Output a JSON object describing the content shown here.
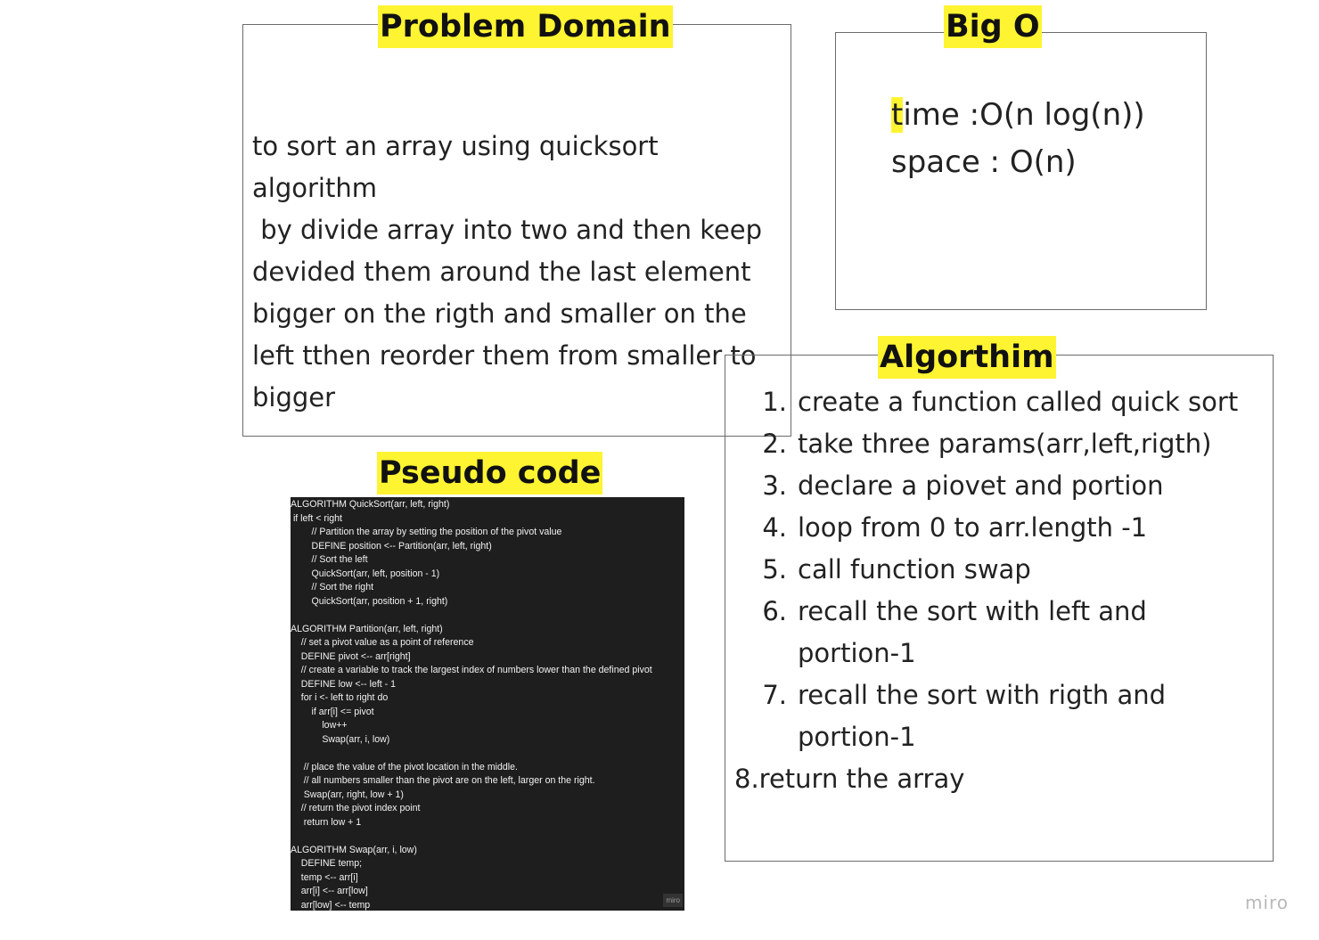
{
  "problem_domain": {
    "heading": "Problem Domain",
    "text": "to sort an array using quicksort algorithm\n by divide array into two and then keep devided them around the last element bigger on the rigth and smaller on the left tthen reorder them from smaller to bigger"
  },
  "big_o": {
    "heading": "Big O",
    "time_highlight": "t",
    "time_rest": "ime :O(n log(n))",
    "space": "space : O(n)"
  },
  "algorithm": {
    "heading": "Algorthim",
    "steps": [
      {
        "num": "1.",
        "text": "create a function called quick sort"
      },
      {
        "num": "2.",
        "text": "take three params(arr,left,rigth)"
      },
      {
        "num": "3.",
        "text": "declare a piovet and portion"
      },
      {
        "num": "4.",
        "text": "loop from 0 to arr.length -1"
      },
      {
        "num": "5.",
        "text": "call function swap"
      },
      {
        "num": "6.",
        "text": "recall the sort with left and portion-1"
      },
      {
        "num": "7.",
        "text": "recall the sort with rigth and portion-1"
      }
    ],
    "final": "8.return the array"
  },
  "pseudo_code": {
    "heading": "Pseudo code",
    "code": "ALGORITHM QuickSort(arr, left, right)\n if left < right\n        // Partition the array by setting the position of the pivot value\n        DEFINE position <-- Partition(arr, left, right)\n        // Sort the left\n        QuickSort(arr, left, position - 1)\n        // Sort the right\n        QuickSort(arr, position + 1, right)\n\nALGORITHM Partition(arr, left, right)\n    // set a pivot value as a point of reference\n    DEFINE pivot <-- arr[right]\n    // create a variable to track the largest index of numbers lower than the defined pivot\n    DEFINE low <-- left - 1\n    for i <- left to right do\n        if arr[i] <= pivot\n            low++\n            Swap(arr, i, low)\n\n     // place the value of the pivot location in the middle.\n     // all numbers smaller than the pivot are on the left, larger on the right.\n     Swap(arr, right, low + 1)\n    // return the pivot index point\n     return low + 1\n\nALGORITHM Swap(arr, i, low)\n    DEFINE temp;\n    temp <-- arr[i]\n    arr[i] <-- arr[low]\n    arr[low] <-- temp",
    "badge": "miro"
  },
  "watermark": "miro",
  "colors": {
    "highlight": "#fff432",
    "code_bg": "#1e1e1e",
    "frame": "#6b6b6b"
  }
}
